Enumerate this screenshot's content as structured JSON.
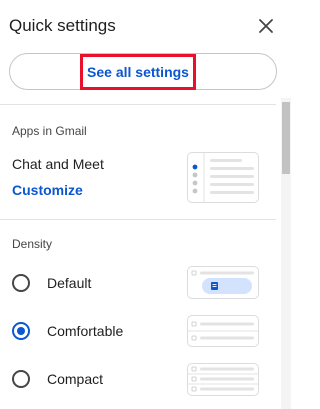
{
  "header": {
    "title": "Quick settings"
  },
  "see_all": {
    "label": "See all settings"
  },
  "apps": {
    "heading": "Apps in Gmail",
    "chat_label": "Chat and Meet",
    "customize_label": "Customize"
  },
  "density": {
    "heading": "Density",
    "options": [
      {
        "label": "Default",
        "selected": false
      },
      {
        "label": "Comfortable",
        "selected": true
      },
      {
        "label": "Compact",
        "selected": false
      }
    ]
  },
  "colors": {
    "accent": "#0b57d0",
    "highlight_border": "#e8102a",
    "thumb_fill": "#d3e3fd"
  }
}
